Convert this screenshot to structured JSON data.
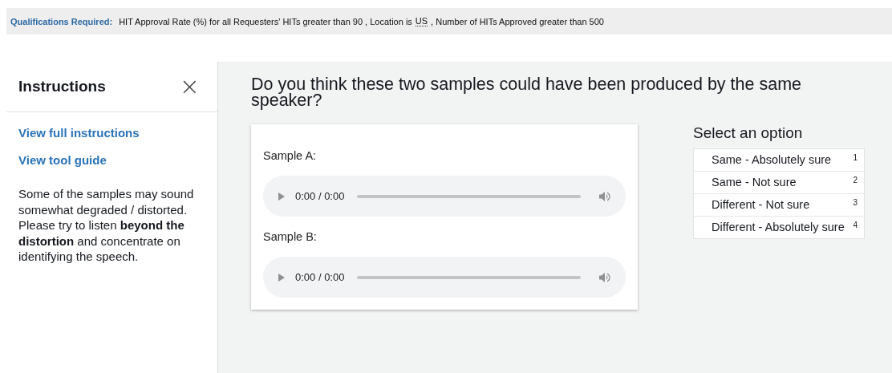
{
  "qualifications": {
    "label": "Qualifications Required:",
    "text_before": "HIT Approval Rate (%) for all Requesters' HITs greater than 90 , Location is",
    "abbr": "US",
    "text_after": ", Number of HITs Approved greater than 500"
  },
  "instructions": {
    "title": "Instructions",
    "close": "×",
    "links": [
      "View full instructions",
      "View tool guide"
    ],
    "body": "Some of the samples may sound somewhat degraded / distorted. Please try to listen **beyond the distortion** and concentrate on identifying the speech."
  },
  "question": "Do you think these two samples could have been produced by the same speaker?",
  "samples": [
    {
      "label": "Sample A:",
      "time": "0:00 / 0:00"
    },
    {
      "label": "Sample B:",
      "time": "0:00 / 0:00"
    }
  ],
  "options": {
    "title": "Select an option",
    "items": [
      {
        "label": "Same - Absolutely sure",
        "key": "1",
        "selected": false
      },
      {
        "label": "Same - Not sure",
        "key": "2",
        "selected": false
      },
      {
        "label": "Different - Not sure",
        "key": "3",
        "selected": false
      },
      {
        "label": "Different - Absolutely sure",
        "key": "4",
        "selected": false
      }
    ]
  }
}
